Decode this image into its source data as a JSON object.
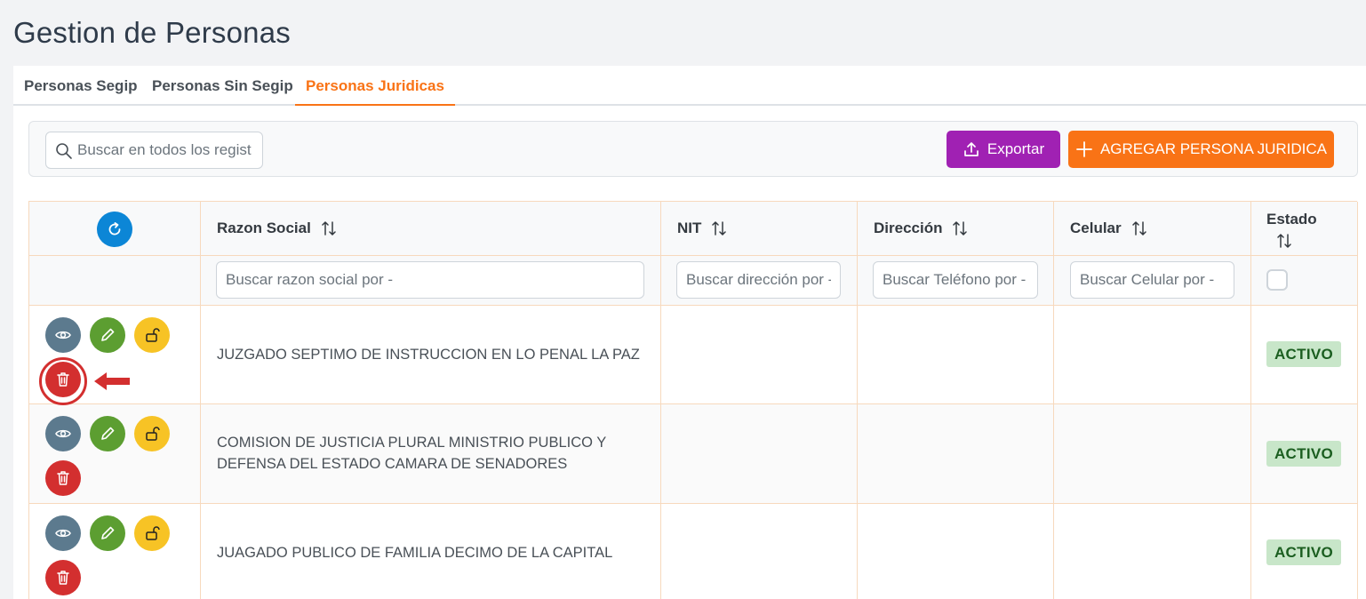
{
  "page": {
    "title": "Gestion de Personas"
  },
  "tabs": [
    {
      "label": "Personas Segip",
      "active": false
    },
    {
      "label": "Personas Sin Segip",
      "active": false
    },
    {
      "label": "Personas Juridicas",
      "active": true
    }
  ],
  "toolbar": {
    "search_placeholder": "Buscar en todos los regist",
    "export_label": "Exportar",
    "add_label": "AGREGAR PERSONA JURIDICA"
  },
  "table": {
    "columns": [
      "Razon Social",
      "NIT",
      "Dirección",
      "Celular",
      "Estado"
    ],
    "filters": {
      "razon_social": "Buscar razon social por -",
      "nit": "Buscar dirección por -",
      "direccion": "Buscar Teléfono por -",
      "celular": "Buscar Celular por -"
    },
    "rows": [
      {
        "razon_social": "JUZGADO SEPTIMO DE INSTRUCCION EN LO PENAL LA PAZ",
        "nit": "",
        "direccion": "",
        "celular": "",
        "estado": "ACTIVO"
      },
      {
        "razon_social": "COMISION DE JUSTICIA PLURAL MINISTRIO PUBLICO Y DEFENSA DEL ESTADO CAMARA DE SENADORES",
        "nit": "",
        "direccion": "",
        "celular": "",
        "estado": "ACTIVO"
      },
      {
        "razon_social": "JUAGADO PUBLICO DE FAMILIA DECIMO DE LA CAPITAL",
        "nit": "",
        "direccion": "",
        "celular": "",
        "estado": "ACTIVO"
      }
    ]
  },
  "icons": {
    "search": "search-icon",
    "export": "upload-icon",
    "add": "plus-icon",
    "refresh": "refresh-icon",
    "sort": "sort-icon",
    "view": "eye-icon",
    "edit": "pencil-icon",
    "unlock": "unlock-icon",
    "delete": "trash-icon",
    "annotation": "arrow-left-icon"
  },
  "colors": {
    "accent": "#f97316",
    "export": "#a021b3",
    "refresh": "#0c86d6",
    "view": "#5c7a8e",
    "edit": "#5c9e31",
    "unlock": "#f7c325",
    "delete": "#d32f2f",
    "badge_bg": "#c8e6c9",
    "badge_text": "#1b5e20"
  }
}
